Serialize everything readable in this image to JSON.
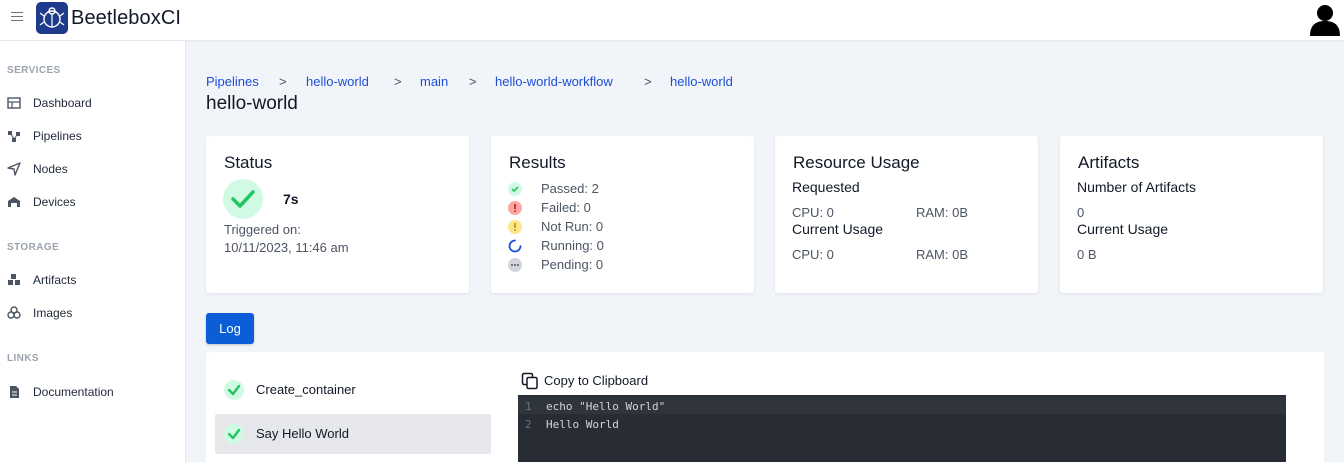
{
  "header": {
    "brand": "BeetleboxCI",
    "menu_icon": "hamburger-menu-icon",
    "avatar_icon": "user-avatar-icon"
  },
  "sidebar": {
    "sections": [
      {
        "title": "SERVICES",
        "items": [
          {
            "label": "Dashboard",
            "icon": "table-icon"
          },
          {
            "label": "Pipelines",
            "icon": "pipeline-icon"
          },
          {
            "label": "Nodes",
            "icon": "send-icon"
          },
          {
            "label": "Devices",
            "icon": "device-icon"
          }
        ]
      },
      {
        "title": "STORAGE",
        "items": [
          {
            "label": "Artifacts",
            "icon": "boxes-icon"
          },
          {
            "label": "Images",
            "icon": "layers-icon"
          }
        ]
      },
      {
        "title": "LINKS",
        "items": [
          {
            "label": "Documentation",
            "icon": "document-icon"
          }
        ]
      }
    ]
  },
  "breadcrumb": [
    "Pipelines",
    "hello-world",
    "main",
    "hello-world-workflow",
    "hello-world"
  ],
  "breadcrumb_sep": ">",
  "page_title": "hello-world",
  "status_card": {
    "title": "Status",
    "duration": "7s",
    "triggered_label": "Triggered on:",
    "triggered_value": "10/11/2023, 11:46 am"
  },
  "results_card": {
    "title": "Results",
    "rows": [
      {
        "label": "Passed: 2",
        "icon": "check-circle-icon"
      },
      {
        "label": "Failed: 0",
        "icon": "error-circle-icon"
      },
      {
        "label": "Not Run: 0",
        "icon": "warning-circle-icon"
      },
      {
        "label": "Running: 0",
        "icon": "spinner-icon"
      },
      {
        "label": "Pending: 0",
        "icon": "pending-dots-icon"
      }
    ]
  },
  "resource_card": {
    "title": "Resource Usage",
    "requested_label": "Requested",
    "requested_cpu": "CPU: 0",
    "requested_ram": "RAM: 0B",
    "current_label": "Current Usage",
    "current_cpu": "CPU: 0",
    "current_ram": "RAM: 0B"
  },
  "artifacts_card": {
    "title": "Artifacts",
    "count_label": "Number of Artifacts",
    "count_value": "0",
    "usage_label": "Current Usage",
    "usage_value": "0 B"
  },
  "log_tab": "Log",
  "steps": [
    {
      "label": "Create_container",
      "active": false
    },
    {
      "label": "Say Hello World",
      "active": true
    }
  ],
  "copy_label": "Copy to Clipboard",
  "log_lines": [
    {
      "num": "1",
      "text": "echo \"Hello World\""
    },
    {
      "num": "2",
      "text": "Hello World"
    }
  ],
  "colors": {
    "accent": "#0b5ed7",
    "success": "#22c55e",
    "error": "#ef4444",
    "warning": "#facc15"
  }
}
